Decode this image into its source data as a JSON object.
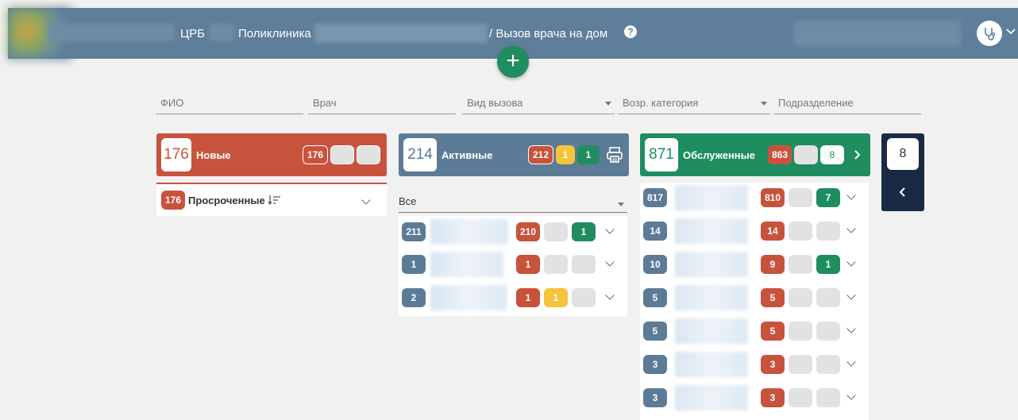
{
  "header": {
    "org": "ЦРБ",
    "clinic": "Поликлиника",
    "breadcrumb": "/ Вызов врача на дом",
    "help_icon": "question-circle-icon",
    "avatar_icon": "stethoscope-icon"
  },
  "add_button": "+",
  "filters": [
    {
      "placeholder": "ФИО"
    },
    {
      "placeholder": "Врач"
    },
    {
      "placeholder": "Вид вызова"
    },
    {
      "placeholder": "Возр. категория"
    },
    {
      "placeholder": "Подразделение"
    }
  ],
  "columns": {
    "new": {
      "count": "176",
      "title": "Новые",
      "badge_red": "176",
      "overdue_count": "176",
      "overdue_label": "Просроченные",
      "sort_icon": "sort-desc-icon"
    },
    "active": {
      "count": "214",
      "title": "Активные",
      "badge_red": "212",
      "badge_yellow": "1",
      "badge_green": "1",
      "print_icon": "printer-icon",
      "filter_value": "Все",
      "rows": [
        {
          "num": "211",
          "red": "210",
          "yellow": "",
          "green": "1"
        },
        {
          "num": "1",
          "red": "1",
          "yellow": "",
          "green": ""
        },
        {
          "num": "2",
          "red": "1",
          "yellow": "1",
          "green": ""
        }
      ]
    },
    "served": {
      "count": "871",
      "title": "Обслуженные",
      "badge_red": "863",
      "badge_green": "8",
      "rows": [
        {
          "num": "817",
          "red": "810",
          "green": "7"
        },
        {
          "num": "14",
          "red": "14",
          "green": ""
        },
        {
          "num": "10",
          "red": "9",
          "green": "1"
        },
        {
          "num": "5",
          "red": "5",
          "green": ""
        },
        {
          "num": "5",
          "red": "5",
          "green": ""
        },
        {
          "num": "3",
          "red": "3",
          "green": ""
        },
        {
          "num": "3",
          "red": "3",
          "green": ""
        }
      ]
    },
    "collapsed": {
      "count": "8"
    }
  },
  "colors": {
    "header": "#5e7e9a",
    "new": "#c8533d",
    "active": "#5c7b96",
    "served": "#1f8d5f",
    "collapsed": "#1b2a44"
  }
}
